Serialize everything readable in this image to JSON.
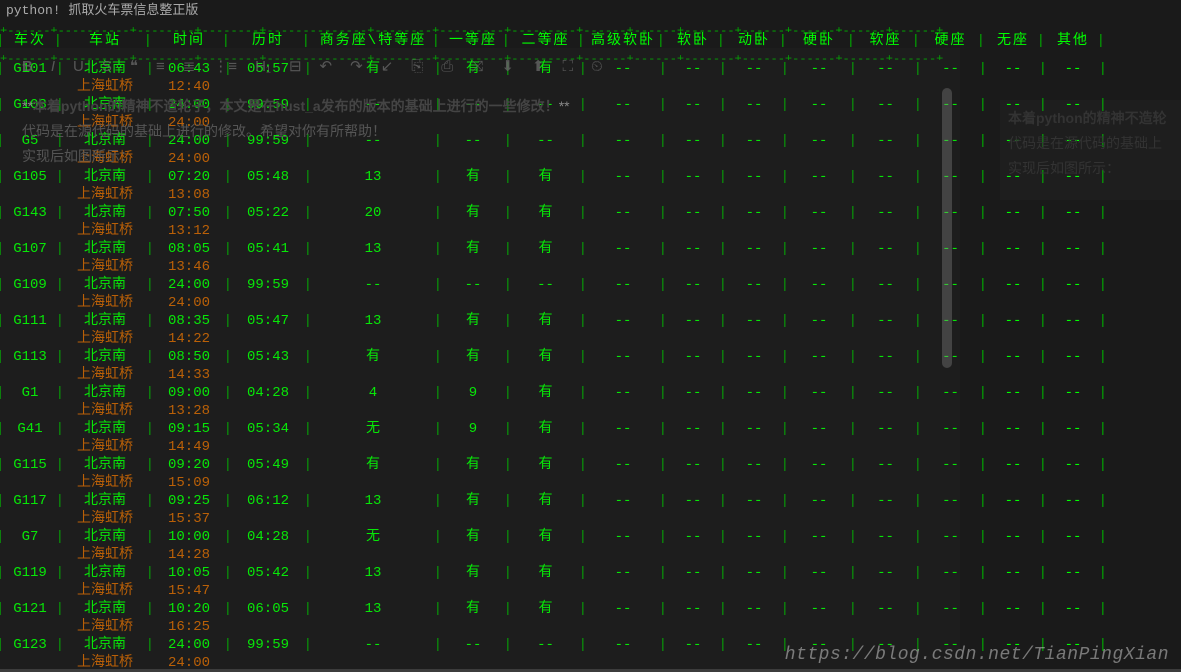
{
  "terminal": {
    "title": "python! 抓取火车票信息整正版",
    "headers": [
      "车次",
      "车站",
      "时间",
      "历时",
      "商务座\\特等座",
      "一等座",
      "二等座",
      "高级软卧",
      "软卧",
      "动卧",
      "硬卧",
      "软座",
      "硬座",
      "无座",
      "其他"
    ],
    "sep": "+------+----------+--------+--------+--------------+--------+---------+---------+------+------+-------+------+------+------+------+",
    "rows": [
      {
        "train": "G101",
        "from": "北京南",
        "to": "上海虹桥",
        "depart": "06:43",
        "arrive": "12:40",
        "dur": "05:57",
        "biz": "有",
        "first": "有",
        "second": "有",
        "advsoft": "--",
        "softsl": "--",
        "dongwo": "--",
        "hardsl": "--",
        "softseat": "--",
        "hardseat": "--",
        "noseat": "--",
        "other": "--"
      },
      {
        "train": "G103",
        "from": "北京南",
        "to": "上海虹桥",
        "depart": "24:00",
        "arrive": "24:00",
        "dur": "99:59",
        "biz": "--",
        "first": "--",
        "second": "--",
        "advsoft": "--",
        "softsl": "--",
        "dongwo": "--",
        "hardsl": "--",
        "softseat": "--",
        "hardseat": "--",
        "noseat": "--",
        "other": "--"
      },
      {
        "train": "G5",
        "from": "北京南",
        "to": "上海虹桥",
        "depart": "24:00",
        "arrive": "24:00",
        "dur": "99:59",
        "biz": "--",
        "first": "--",
        "second": "--",
        "advsoft": "--",
        "softsl": "--",
        "dongwo": "--",
        "hardsl": "--",
        "softseat": "--",
        "hardseat": "--",
        "noseat": "--",
        "other": "--"
      },
      {
        "train": "G105",
        "from": "北京南",
        "to": "上海虹桥",
        "depart": "07:20",
        "arrive": "13:08",
        "dur": "05:48",
        "biz": "13",
        "first": "有",
        "second": "有",
        "advsoft": "--",
        "softsl": "--",
        "dongwo": "--",
        "hardsl": "--",
        "softseat": "--",
        "hardseat": "--",
        "noseat": "--",
        "other": "--"
      },
      {
        "train": "G143",
        "from": "北京南",
        "to": "上海虹桥",
        "depart": "07:50",
        "arrive": "13:12",
        "dur": "05:22",
        "biz": "20",
        "first": "有",
        "second": "有",
        "advsoft": "--",
        "softsl": "--",
        "dongwo": "--",
        "hardsl": "--",
        "softseat": "--",
        "hardseat": "--",
        "noseat": "--",
        "other": "--"
      },
      {
        "train": "G107",
        "from": "北京南",
        "to": "上海虹桥",
        "depart": "08:05",
        "arrive": "13:46",
        "dur": "05:41",
        "biz": "13",
        "first": "有",
        "second": "有",
        "advsoft": "--",
        "softsl": "--",
        "dongwo": "--",
        "hardsl": "--",
        "softseat": "--",
        "hardseat": "--",
        "noseat": "--",
        "other": "--"
      },
      {
        "train": "G109",
        "from": "北京南",
        "to": "上海虹桥",
        "depart": "24:00",
        "arrive": "24:00",
        "dur": "99:59",
        "biz": "--",
        "first": "--",
        "second": "--",
        "advsoft": "--",
        "softsl": "--",
        "dongwo": "--",
        "hardsl": "--",
        "softseat": "--",
        "hardseat": "--",
        "noseat": "--",
        "other": "--"
      },
      {
        "train": "G111",
        "from": "北京南",
        "to": "上海虹桥",
        "depart": "08:35",
        "arrive": "14:22",
        "dur": "05:47",
        "biz": "13",
        "first": "有",
        "second": "有",
        "advsoft": "--",
        "softsl": "--",
        "dongwo": "--",
        "hardsl": "--",
        "softseat": "--",
        "hardseat": "--",
        "noseat": "--",
        "other": "--"
      },
      {
        "train": "G113",
        "from": "北京南",
        "to": "上海虹桥",
        "depart": "08:50",
        "arrive": "14:33",
        "dur": "05:43",
        "biz": "有",
        "first": "有",
        "second": "有",
        "advsoft": "--",
        "softsl": "--",
        "dongwo": "--",
        "hardsl": "--",
        "softseat": "--",
        "hardseat": "--",
        "noseat": "--",
        "other": "--"
      },
      {
        "train": "G1",
        "from": "北京南",
        "to": "上海虹桥",
        "depart": "09:00",
        "arrive": "13:28",
        "dur": "04:28",
        "biz": "4",
        "first": "9",
        "second": "有",
        "advsoft": "--",
        "softsl": "--",
        "dongwo": "--",
        "hardsl": "--",
        "softseat": "--",
        "hardseat": "--",
        "noseat": "--",
        "other": "--"
      },
      {
        "train": "G41",
        "from": "北京南",
        "to": "上海虹桥",
        "depart": "09:15",
        "arrive": "14:49",
        "dur": "05:34",
        "biz": "无",
        "first": "9",
        "second": "有",
        "advsoft": "--",
        "softsl": "--",
        "dongwo": "--",
        "hardsl": "--",
        "softseat": "--",
        "hardseat": "--",
        "noseat": "--",
        "other": "--"
      },
      {
        "train": "G115",
        "from": "北京南",
        "to": "上海虹桥",
        "depart": "09:20",
        "arrive": "15:09",
        "dur": "05:49",
        "biz": "有",
        "first": "有",
        "second": "有",
        "advsoft": "--",
        "softsl": "--",
        "dongwo": "--",
        "hardsl": "--",
        "softseat": "--",
        "hardseat": "--",
        "noseat": "--",
        "other": "--"
      },
      {
        "train": "G117",
        "from": "北京南",
        "to": "上海虹桥",
        "depart": "09:25",
        "arrive": "15:37",
        "dur": "06:12",
        "biz": "13",
        "first": "有",
        "second": "有",
        "advsoft": "--",
        "softsl": "--",
        "dongwo": "--",
        "hardsl": "--",
        "softseat": "--",
        "hardseat": "--",
        "noseat": "--",
        "other": "--"
      },
      {
        "train": "G7",
        "from": "北京南",
        "to": "上海虹桥",
        "depart": "10:00",
        "arrive": "14:28",
        "dur": "04:28",
        "biz": "无",
        "first": "有",
        "second": "有",
        "advsoft": "--",
        "softsl": "--",
        "dongwo": "--",
        "hardsl": "--",
        "softseat": "--",
        "hardseat": "--",
        "noseat": "--",
        "other": "--"
      },
      {
        "train": "G119",
        "from": "北京南",
        "to": "上海虹桥",
        "depart": "10:05",
        "arrive": "15:47",
        "dur": "05:42",
        "biz": "13",
        "first": "有",
        "second": "有",
        "advsoft": "--",
        "softsl": "--",
        "dongwo": "--",
        "hardsl": "--",
        "softseat": "--",
        "hardseat": "--",
        "noseat": "--",
        "other": "--"
      },
      {
        "train": "G121",
        "from": "北京南",
        "to": "上海虹桥",
        "depart": "10:20",
        "arrive": "16:25",
        "dur": "06:05",
        "biz": "13",
        "first": "有",
        "second": "有",
        "advsoft": "--",
        "softsl": "--",
        "dongwo": "--",
        "hardsl": "--",
        "softseat": "--",
        "hardseat": "--",
        "noseat": "--",
        "other": "--"
      },
      {
        "train": "G123",
        "from": "北京南",
        "to": "上海虹桥",
        "depart": "24:00",
        "arrive": "24:00",
        "dur": "99:59",
        "biz": "--",
        "first": "--",
        "second": "--",
        "advsoft": "--",
        "softsl": "--",
        "dongwo": "--",
        "hardsl": "--",
        "softseat": "--",
        "hardseat": "--",
        "noseat": "--",
        "other": "--"
      }
    ]
  },
  "editor": {
    "line1": "本着python的精神不造轮子，本文是在hust_a发布的版本的基础上进行的一些修改！",
    "line2": "代码是在源代码的基础上进行的修改。希望对你有所帮助！",
    "line3": "实现后如图所示：",
    "toolbar_icons": [
      "B",
      "I",
      "U",
      "S",
      "❝",
      "≡",
      "≣",
      "⋮≡",
      "H₁",
      "⊟",
      "↶",
      "↷",
      "↙",
      "⎘",
      "⎙",
      "⤨",
      "⬇",
      "⬆",
      "⛶",
      "⏲"
    ]
  },
  "preview": {
    "line1": "本着python的精神不造轮",
    "line2": "代码是在源代码的基础上",
    "line3": "实现后如图所示："
  },
  "watermark": "https://blog.csdn.net/TianPingXian"
}
